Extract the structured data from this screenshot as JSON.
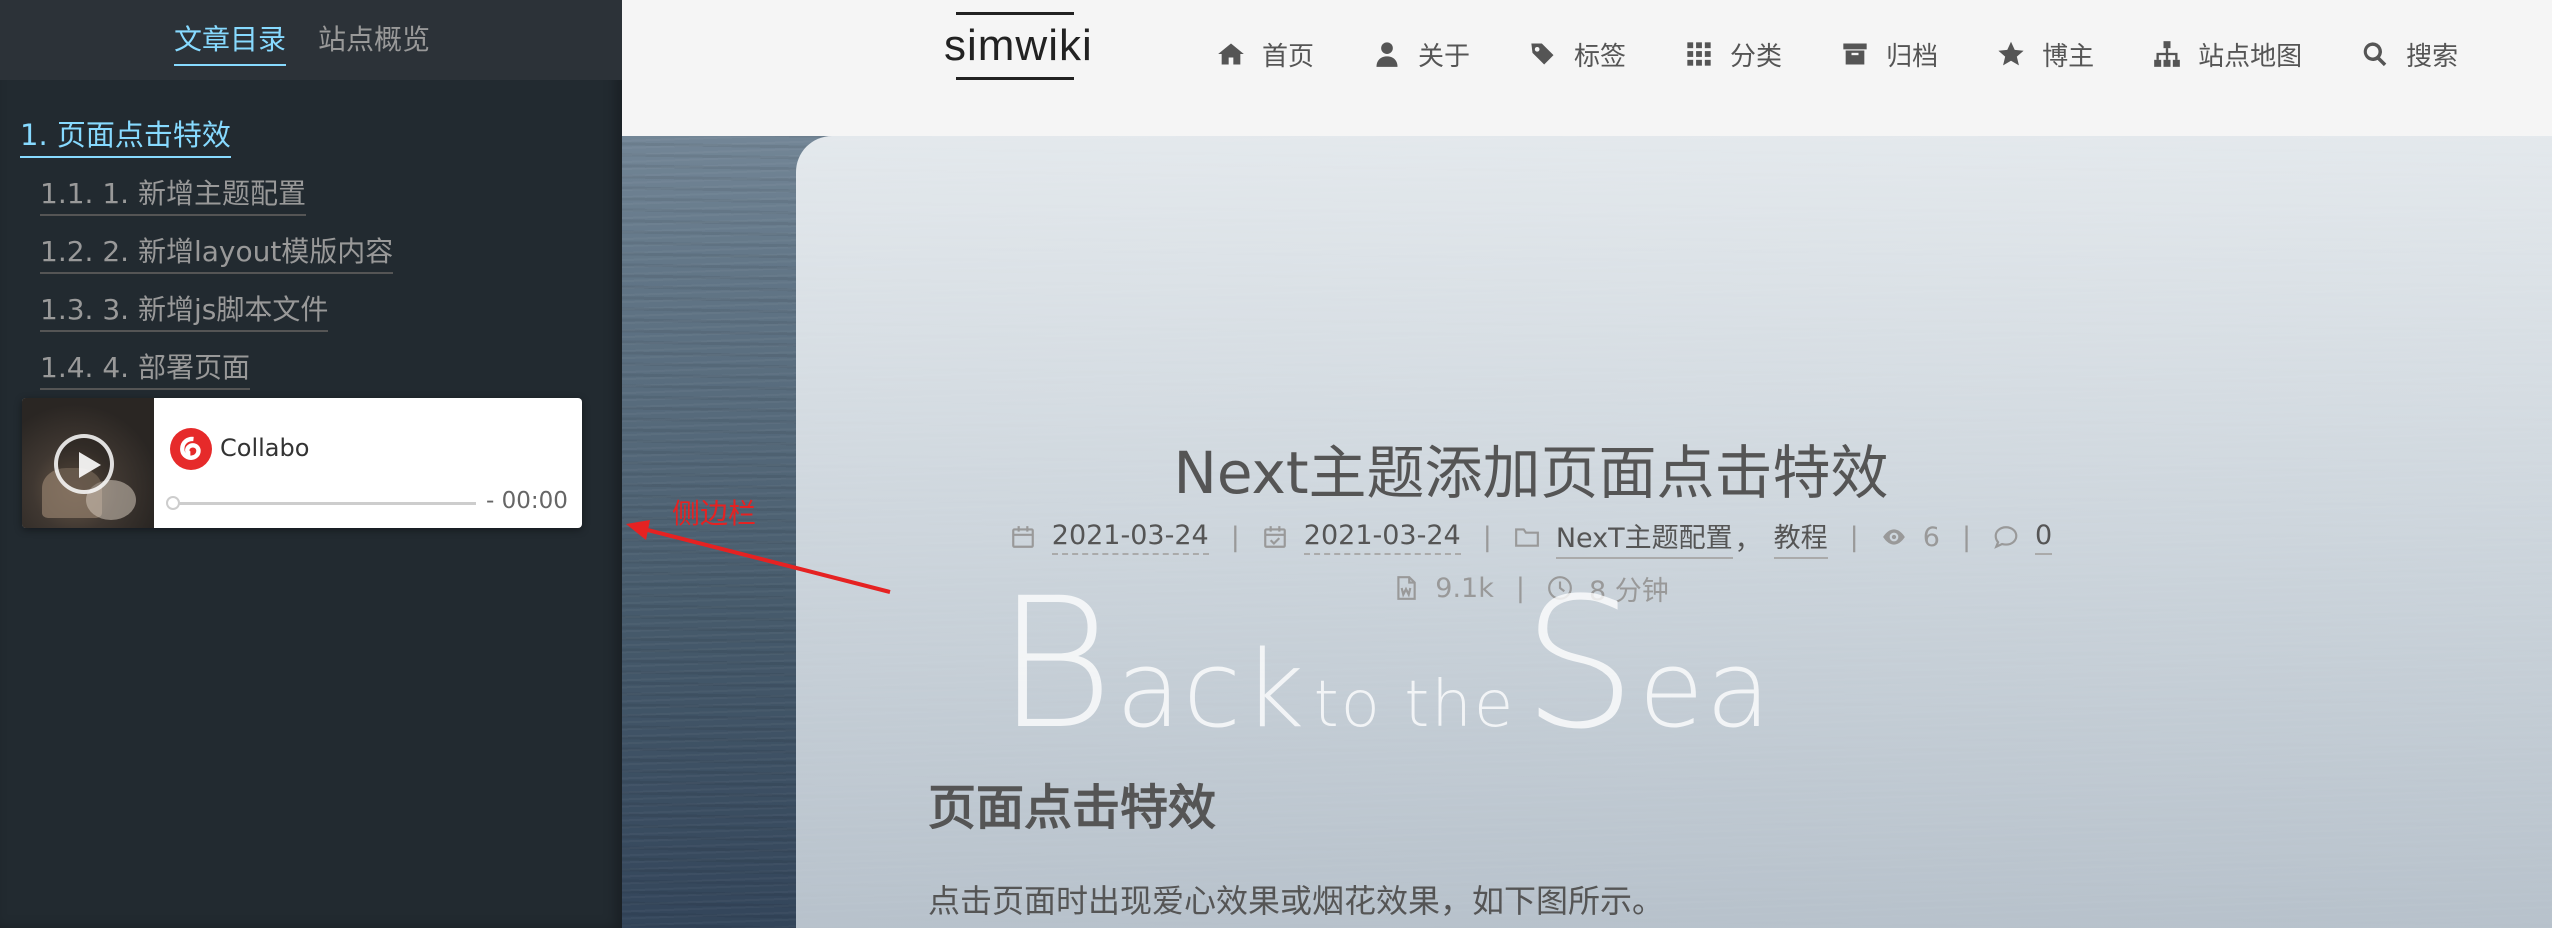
{
  "sidebar": {
    "tabs": [
      {
        "label": "文章目录",
        "active": true
      },
      {
        "label": "站点概览",
        "active": false
      }
    ],
    "toc": [
      {
        "label": "1. 页面点击特效",
        "level": 1
      },
      {
        "label": "1.1. 1. 新增主题配置",
        "level": 2
      },
      {
        "label": "1.2. 2. 新增layout模版内容",
        "level": 2
      },
      {
        "label": "1.3. 3. 新增js脚本文件",
        "level": 2
      },
      {
        "label": "1.4. 4. 部署页面",
        "level": 2
      }
    ],
    "player": {
      "song": "Collabo",
      "time": "- 00:00",
      "progress": 0
    }
  },
  "header": {
    "brand": "simwiki",
    "menu": [
      {
        "label": "首页",
        "icon": "home-icon"
      },
      {
        "label": "关于",
        "icon": "user-icon"
      },
      {
        "label": "标签",
        "icon": "tags-icon"
      },
      {
        "label": "分类",
        "icon": "grid-icon"
      },
      {
        "label": "归档",
        "icon": "archive-icon"
      },
      {
        "label": "博主",
        "icon": "star-icon"
      },
      {
        "label": "站点地图",
        "icon": "sitemap-icon"
      },
      {
        "label": "搜索",
        "icon": "search-icon"
      }
    ]
  },
  "post": {
    "title": "Next主题添加页面点击特效",
    "created": "2021-03-24",
    "updated": "2021-03-24",
    "category_1": "NexT主题配置",
    "category_sep": "，",
    "category_2": "教程",
    "views": "6",
    "comments": "0",
    "word_count": "9.1k",
    "read_time": "8 分钟",
    "watermark": {
      "b": "B",
      "ack": "ack",
      "to_the": "to the",
      "s": "S",
      "ea": "ea"
    },
    "section_heading": "页面点击特效",
    "paragraph": "点击页面时出现爱心效果或烟花效果，如下图所示。"
  },
  "annotation": {
    "label": "侧边栏",
    "color": "#e52222"
  },
  "colors": {
    "accent": "#87daff",
    "sidebar_bg": "#222a30",
    "header_bg": "#f5f5f5"
  }
}
